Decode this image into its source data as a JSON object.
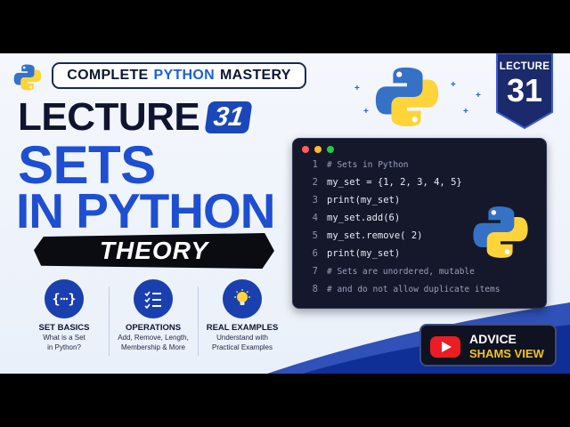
{
  "series": {
    "prefix": "COMPLETE",
    "highlight": "PYTHON",
    "suffix": "MASTERY"
  },
  "title": {
    "lecture_word": "LECTURE",
    "lecture_number": "31",
    "line1": "SETS",
    "line2": "IN PYTHON",
    "tag": "THEORY"
  },
  "badge": {
    "label": "LECTURE",
    "number": "31"
  },
  "features": [
    {
      "icon": "braces-dots-icon",
      "title": "SET BASICS",
      "desc1": "What is a Set",
      "desc2": "in Python?"
    },
    {
      "icon": "checklist-icon",
      "title": "OPERATIONS",
      "desc1": "Add, Remove, Length,",
      "desc2": "Membership & More"
    },
    {
      "icon": "lightbulb-icon",
      "title": "REAL EXAMPLES",
      "desc1": "Understand with",
      "desc2": "Practical Examples"
    }
  ],
  "code": {
    "lines": [
      {
        "n": "1",
        "text": "# Sets in Python"
      },
      {
        "n": "2",
        "text": "my_set = {1, 2, 3, 4, 5}"
      },
      {
        "n": "3",
        "text": "print(my_set)"
      },
      {
        "n": "4",
        "text": "my_set.add(6)"
      },
      {
        "n": "5",
        "text": "my_set.remove( 2)"
      },
      {
        "n": "6",
        "text": "print(my_set)"
      },
      {
        "n": "7",
        "text": "# Sets are unordered, mutable"
      },
      {
        "n": "8",
        "text": "# and do not allow duplicate items"
      }
    ]
  },
  "channel": {
    "line1": "ADVICE",
    "line2": "SHAMS VIEW"
  },
  "colors": {
    "accent": "#1e4fd0",
    "python_blue": "#3572c6",
    "python_yellow": "#ffd43b",
    "youtube_red": "#ea1d25",
    "channel_gold": "#f5c518"
  }
}
